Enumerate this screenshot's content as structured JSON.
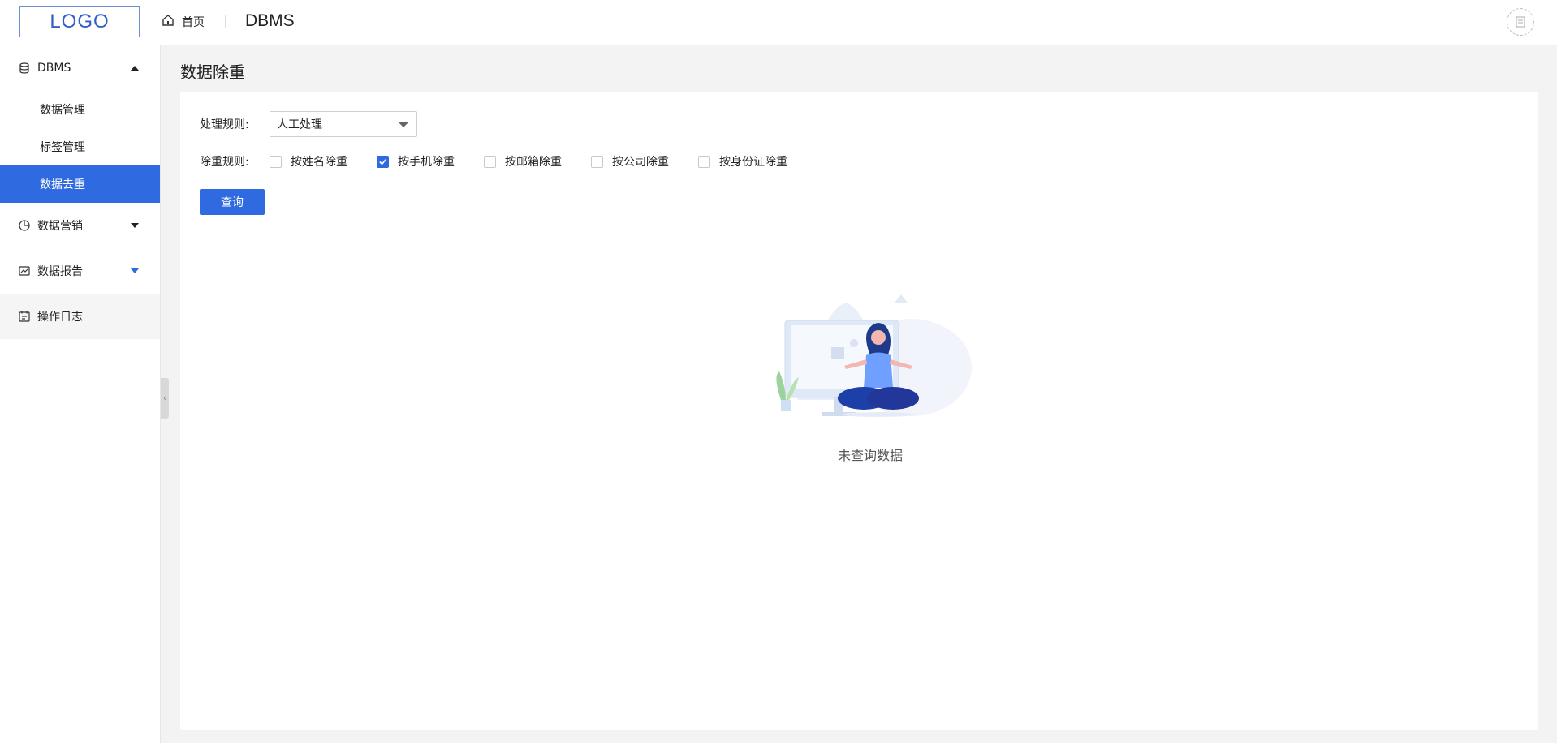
{
  "header": {
    "logo_text": "LOGO",
    "home_label": "首页",
    "app_title": "DBMS"
  },
  "sidebar": {
    "groups": [
      {
        "label": "DBMS",
        "icon": "database-icon",
        "expanded": true,
        "items": [
          {
            "label": "数据管理",
            "active": false
          },
          {
            "label": "标签管理",
            "active": false
          },
          {
            "label": "数据去重",
            "active": true
          }
        ]
      },
      {
        "label": "数据营销",
        "icon": "pie-chart-icon",
        "expanded": false
      },
      {
        "label": "数据报告",
        "icon": "line-chart-icon",
        "expanded": false
      },
      {
        "label": "操作日志",
        "icon": "calendar-icon"
      }
    ]
  },
  "main": {
    "page_title": "数据除重",
    "rule_label": "处理规则:",
    "rule_value": "人工处理",
    "dedup_label": "除重规则:",
    "options": [
      {
        "label": "按姓名除重",
        "checked": false
      },
      {
        "label": "按手机除重",
        "checked": true
      },
      {
        "label": "按邮箱除重",
        "checked": false
      },
      {
        "label": "按公司除重",
        "checked": false
      },
      {
        "label": "按身份证除重",
        "checked": false
      }
    ],
    "query_label": "查询",
    "empty_text": "未查询数据"
  },
  "colors": {
    "accent": "#2f6ae0",
    "page_bg": "#f3f3f3"
  }
}
